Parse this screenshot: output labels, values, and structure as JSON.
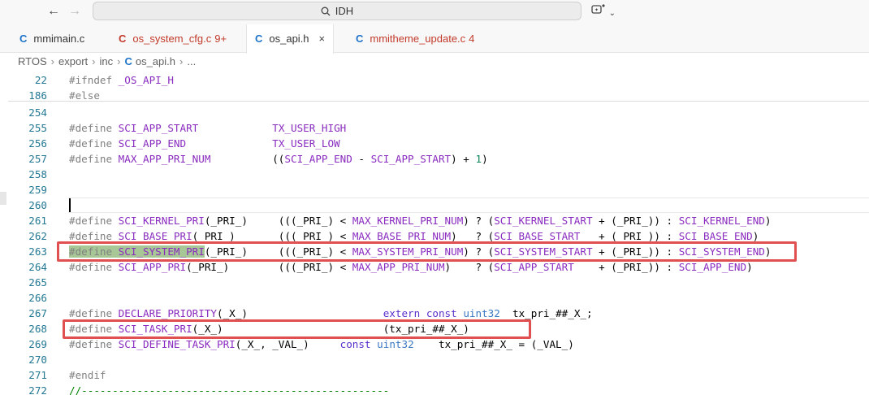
{
  "search": {
    "text": "IDH"
  },
  "tabs": [
    {
      "label": "mmimain.c",
      "badge": ""
    },
    {
      "label": "os_system_cfg.c",
      "badge": "9+"
    },
    {
      "label": "os_api.h",
      "badge": "",
      "close": "×"
    },
    {
      "label": "mmitheme_update.c",
      "badge": "4"
    }
  ],
  "breadcrumb": {
    "parts": [
      "RTOS",
      "export",
      "inc",
      "os_api.h",
      "..."
    ]
  },
  "colors": {
    "highlight_box": "#e05050",
    "line_number": "#237893",
    "macro": "#8a2bbf"
  },
  "lines": [
    {
      "num": "22",
      "code": "#ifndef _OS_API_H"
    },
    {
      "num": "186",
      "code": "#else"
    },
    {
      "num": "254",
      "code": ""
    },
    {
      "num": "255",
      "code": "#define SCI_APP_START            TX_USER_HIGH"
    },
    {
      "num": "256",
      "code": "#define SCI_APP_END              TX_USER_LOW"
    },
    {
      "num": "257",
      "code": "#define MAX_APP_PRI_NUM          ((SCI_APP_END - SCI_APP_START) + 1)"
    },
    {
      "num": "258",
      "code": ""
    },
    {
      "num": "259",
      "code": ""
    },
    {
      "num": "260",
      "code": ""
    },
    {
      "num": "261",
      "code": "#define SCI_KERNEL_PRI(_PRI_)     (((_PRI_) < MAX_KERNEL_PRI_NUM) ? (SCI_KERNEL_START + (_PRI_)) : SCI_KERNEL_END)"
    },
    {
      "num": "262",
      "code": "#define SCI_BASE_PRI(_PRI_)       (((_PRI_) < MAX_BASE_PRI_NUM)   ? (SCI_BASE_START   + (_PRI_)) : SCI_BASE_END)"
    },
    {
      "num": "263",
      "code": "#define SCI_SYSTEM_PRI(_PRI_)     (((_PRI_) < MAX_SYSTEM_PRI_NUM) ? (SCI_SYSTEM_START + (_PRI_)) : SCI_SYSTEM_END)"
    },
    {
      "num": "264",
      "code": "#define SCI_APP_PRI(_PRI_)        (((_PRI_) < MAX_APP_PRI_NUM)    ? (SCI_APP_START    + (_PRI_)) : SCI_APP_END)"
    },
    {
      "num": "265",
      "code": ""
    },
    {
      "num": "266",
      "code": ""
    },
    {
      "num": "267",
      "code": "#define DECLARE_PRIORITY(_X_)                      extern const uint32  tx_pri_##_X_;"
    },
    {
      "num": "268",
      "code": "#define SCI_TASK_PRI(_X_)                          (tx_pri_##_X_)"
    },
    {
      "num": "269",
      "code": "#define SCI_DEFINE_TASK_PRI(_X_, _VAL_)     const uint32    tx_pri_##_X_ = (_VAL_)"
    },
    {
      "num": "270",
      "code": ""
    },
    {
      "num": "271",
      "code": "#endif"
    },
    {
      "num": "272",
      "code": "//--------------------------------------------------"
    }
  ]
}
